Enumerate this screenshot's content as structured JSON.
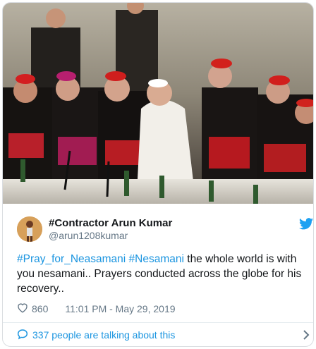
{
  "tweet": {
    "display_name": "#Contractor Arun Kumar",
    "handle": "@arun1208kumar",
    "hashtag_1": "#Pray_for_Neasamani",
    "hashtag_2": "#Nesamani",
    "body_text": " the whole world is with you nesamani.. Prayers conducted across the globe for his recovery..",
    "like_count": "860",
    "timestamp": "11:01 PM - May 29, 2019",
    "conversation_label": "337 people are talking about this"
  },
  "icons": {
    "platform": "twitter-bird-icon",
    "like": "heart-icon",
    "conversation": "speech-bubble-icon",
    "more": "chevron-right-icon"
  },
  "colors": {
    "link": "#1b95e0",
    "text": "#14171a",
    "muted": "#657786"
  }
}
